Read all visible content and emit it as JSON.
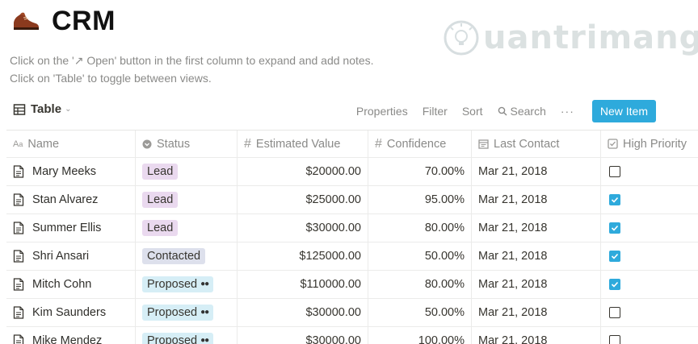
{
  "page": {
    "title": "CRM",
    "title_icon": "shoe-icon",
    "description": [
      "Click on the '↗ Open' button in the first column to expand and add notes.",
      "Click on 'Table' to toggle between views."
    ]
  },
  "watermark": {
    "text": "uantrimang"
  },
  "toolbar": {
    "view_label": "Table",
    "properties_label": "Properties",
    "filter_label": "Filter",
    "sort_label": "Sort",
    "search_label": "Search",
    "more_label": "···",
    "new_item_label": "New Item"
  },
  "table": {
    "columns": {
      "name": "Name",
      "status": "Status",
      "estimated_value": "Estimated Value",
      "confidence": "Confidence",
      "last_contact": "Last Contact",
      "high_priority": "High Priority"
    },
    "rows": [
      {
        "name": "Mary Meeks",
        "status": "Lead",
        "estimated_value": "$20000.00",
        "confidence": "70.00%",
        "last_contact": "Mar 21, 2018",
        "high_priority": false
      },
      {
        "name": "Stan Alvarez",
        "status": "Lead",
        "estimated_value": "$25000.00",
        "confidence": "95.00%",
        "last_contact": "Mar 21, 2018",
        "high_priority": true
      },
      {
        "name": "Summer Ellis",
        "status": "Lead",
        "estimated_value": "$30000.00",
        "confidence": "80.00%",
        "last_contact": "Mar 21, 2018",
        "high_priority": true
      },
      {
        "name": "Shri Ansari",
        "status": "Contacted",
        "estimated_value": "$125000.00",
        "confidence": "50.00%",
        "last_contact": "Mar 21, 2018",
        "high_priority": true
      },
      {
        "name": "Mitch Cohn",
        "status": "Proposed",
        "estimated_value": "$110000.00",
        "confidence": "80.00%",
        "last_contact": "Mar 21, 2018",
        "high_priority": true
      },
      {
        "name": "Kim Saunders",
        "status": "Proposed",
        "estimated_value": "$30000.00",
        "confidence": "50.00%",
        "last_contact": "Mar 21, 2018",
        "high_priority": false
      },
      {
        "name": "Mike Mendez",
        "status": "Proposed",
        "estimated_value": "$30000.00",
        "confidence": "100.00%",
        "last_contact": "Mar 21, 2018",
        "high_priority": false
      }
    ]
  },
  "status_colors": {
    "Lead": "#ead9ef",
    "Contacted": "#dde0ec",
    "Proposed": "#d6eef6"
  },
  "accent_color": "#2eaadc"
}
